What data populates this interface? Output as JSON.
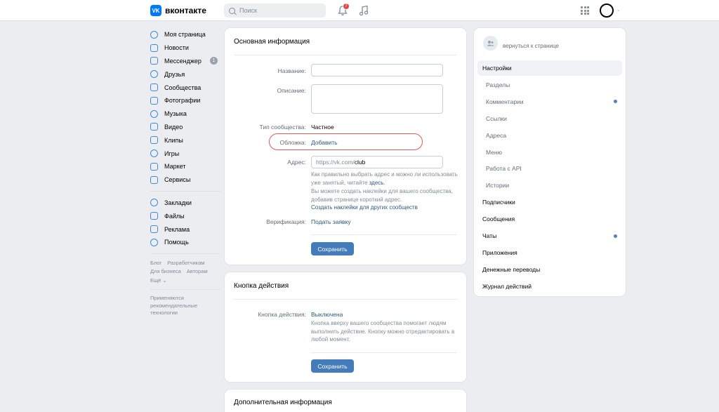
{
  "header": {
    "logo_badge": "VK",
    "logo_text": "вконтакте",
    "search_placeholder": "Поиск",
    "notifications_count": "7"
  },
  "sidebar": {
    "items": [
      {
        "label": "Моя страница",
        "icon": "user-circle-icon"
      },
      {
        "label": "Новости",
        "icon": "news-icon"
      },
      {
        "label": "Мессенджер",
        "icon": "message-icon",
        "count": "1"
      },
      {
        "label": "Друзья",
        "icon": "friends-icon"
      },
      {
        "label": "Сообщества",
        "icon": "communities-icon"
      },
      {
        "label": "Фотографии",
        "icon": "photo-icon"
      },
      {
        "label": "Музыка",
        "icon": "music-icon"
      },
      {
        "label": "Видео",
        "icon": "video-icon"
      },
      {
        "label": "Клипы",
        "icon": "clips-icon"
      },
      {
        "label": "Игры",
        "icon": "games-icon"
      },
      {
        "label": "Маркет",
        "icon": "market-icon"
      },
      {
        "label": "Сервисы",
        "icon": "services-icon"
      }
    ],
    "items2": [
      {
        "label": "Закладки",
        "icon": "bookmark-icon"
      },
      {
        "label": "Файлы",
        "icon": "file-icon"
      },
      {
        "label": "Реклама",
        "icon": "ads-icon"
      },
      {
        "label": "Помощь",
        "icon": "help-icon"
      }
    ],
    "footer_links": [
      "Блог",
      "Разработчикам",
      "Для бизнеса",
      "Авторам",
      "Ещё ⌄"
    ],
    "note": "Применяются рекомендательные технологии"
  },
  "main_info": {
    "title": "Основная информация",
    "name_label": "Название:",
    "description_label": "Описание:",
    "type_label": "Тип сообщества:",
    "type_value": "Частное",
    "cover_label": "Обложка:",
    "cover_link": "Добавить",
    "address_label": "Адрес:",
    "address_prefix": "https://vk.com/",
    "address_value": "club",
    "address_hint_1": "Как правильно выбрать адрес и можно ли использовать уже занятый, читайте ",
    "address_hint_link": "здесь",
    "address_hint_2": "Вы можете создать наклейки для вашего сообщества, добавив странице короткий адрес.",
    "stickers_link": "Создать наклейки для других сообществ",
    "verification_label": "Верификация:",
    "verification_link": "Подать заявку",
    "save_label": "Сохранить"
  },
  "action_button": {
    "title": "Кнопка действия",
    "label": "Кнопка действия:",
    "value": "Выключена",
    "hint": "Кнопка вверху вашего сообщества помогает людям выполнить действие. Кнопку можно отредактировать в любой момент.",
    "save_label": "Сохранить"
  },
  "extra_info": {
    "title": "Дополнительная информация"
  },
  "right_nav": {
    "back_label": "вернуться к странице",
    "items": [
      {
        "label": "Настройки",
        "level": "main",
        "active": true
      },
      {
        "label": "Разделы",
        "level": "sub"
      },
      {
        "label": "Комментарии",
        "level": "sub",
        "dot": true
      },
      {
        "label": "Ссылки",
        "level": "sub"
      },
      {
        "label": "Адреса",
        "level": "sub"
      },
      {
        "label": "Меню",
        "level": "sub"
      },
      {
        "label": "Работа с API",
        "level": "sub"
      },
      {
        "label": "Истории",
        "level": "sub"
      },
      {
        "label": "Подписчики",
        "level": "main"
      },
      {
        "label": "Сообщения",
        "level": "main"
      },
      {
        "label": "Чаты",
        "level": "main",
        "dot": true
      },
      {
        "label": "Приложения",
        "level": "main"
      },
      {
        "label": "Денежные переводы",
        "level": "main"
      },
      {
        "label": "Журнал действий",
        "level": "main"
      }
    ]
  },
  "colors": {
    "accent": "#447bba",
    "link": "#2a5885",
    "highlight": "#e35a5a"
  }
}
